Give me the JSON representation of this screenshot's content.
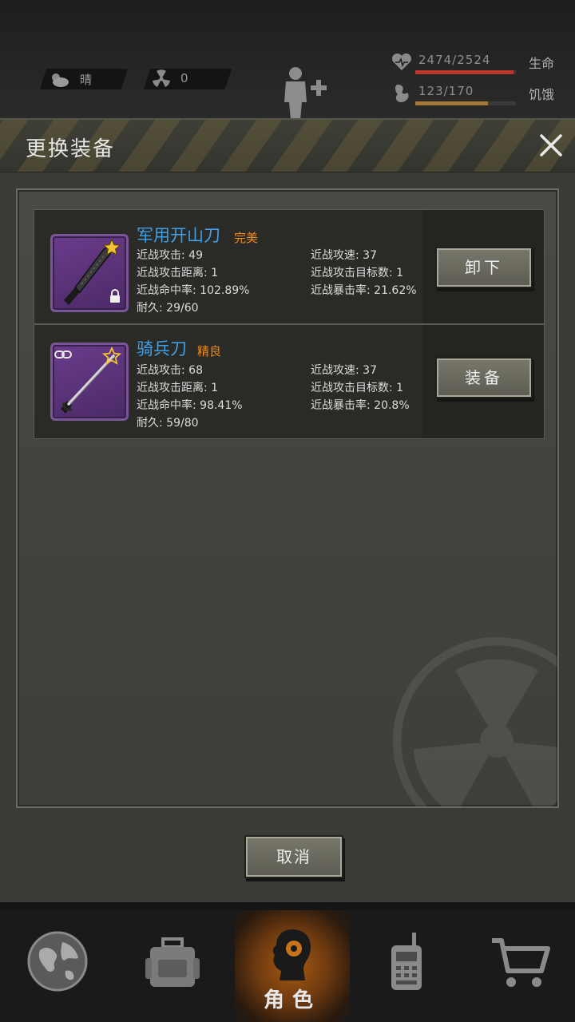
{
  "hud": {
    "weather": {
      "label": "晴"
    },
    "radiation": {
      "value": "0"
    },
    "health": {
      "value": "2474/2524",
      "label": "生命",
      "fraction": 0.98,
      "color": "#b8362a"
    },
    "hunger": {
      "value": "123/170",
      "label": "饥饿",
      "fraction": 0.72,
      "color": "#a4773a"
    }
  },
  "dialog": {
    "title": "更换装备",
    "items": [
      {
        "name": "军用开山刀",
        "quality": "完美",
        "stats": {
          "attack": "近战攻击: 49",
          "speed": "近战攻速: 37",
          "range": "近战攻击距离: 1",
          "targets": "近战攻击目标数: 1",
          "hit": "近战命中率: 102.89%",
          "crit": "近战暴击率: 21.62%",
          "durability": "耐久: 29/60"
        },
        "action": "卸下",
        "locked": true,
        "star_filled": true
      },
      {
        "name": "骑兵刀",
        "quality": "精良",
        "stats": {
          "attack": "近战攻击: 68",
          "speed": "近战攻速: 37",
          "range": "近战攻击距离: 1",
          "targets": "近战攻击目标数: 1",
          "hit": "近战命中率: 98.41%",
          "crit": "近战暴击率: 20.8%",
          "durability": "耐久: 59/80"
        },
        "action": "装备",
        "locked": false,
        "star_filled": false
      }
    ],
    "cancel": "取消"
  },
  "nav": {
    "items": [
      {
        "icon": "globe-icon",
        "label": ""
      },
      {
        "icon": "backpack-icon",
        "label": ""
      },
      {
        "icon": "character-icon",
        "label": "角色",
        "active": true
      },
      {
        "icon": "radio-icon",
        "label": ""
      },
      {
        "icon": "cart-icon",
        "label": ""
      }
    ]
  }
}
